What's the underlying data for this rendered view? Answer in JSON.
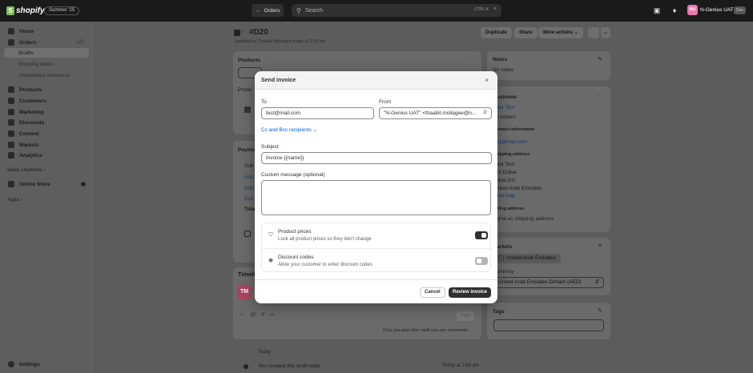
{
  "topbar": {
    "logo": "shopify",
    "season_badge": "Summer '25",
    "orders_button": "Orders",
    "search_placeholder": "Search",
    "search_shortcut": "CTRL K",
    "store_initials": "NU",
    "store_name": "N-Genius UAT",
    "dev_badge": "Dev"
  },
  "sidebar": {
    "items": [
      {
        "label": "Home",
        "icon": "home-icon"
      },
      {
        "label": "Orders",
        "icon": "orders-icon",
        "count": "125"
      },
      {
        "label": "Drafts",
        "sub": true,
        "active": true
      },
      {
        "label": "Shipping labels",
        "sub": true
      },
      {
        "label": "Abandoned checkouts",
        "sub": true
      },
      {
        "label": "Products",
        "icon": "tag-icon"
      },
      {
        "label": "Customers",
        "icon": "person-icon"
      },
      {
        "label": "Marketing",
        "icon": "target-icon"
      },
      {
        "label": "Discounts",
        "icon": "discount-icon"
      },
      {
        "label": "Content",
        "icon": "content-icon"
      },
      {
        "label": "Markets",
        "icon": "globe-icon"
      },
      {
        "label": "Analytics",
        "icon": "chart-icon"
      }
    ],
    "sales_channels_label": "Sales channels",
    "online_store_label": "Online Store",
    "apps_label": "Apps",
    "settings_label": "Settings"
  },
  "page": {
    "title": "#D20",
    "subtitle": "Updated by Thaabit Mollagee today at 2:56 am",
    "duplicate_button": "Duplicate",
    "share_button": "Share",
    "more_actions_button": "More actions",
    "products_card_title": "Products",
    "products_row_label": "Produ",
    "payment_card_title": "Payme",
    "payment_lines": [
      "Sub",
      "Add",
      "Add",
      "Esti",
      "Tota"
    ],
    "timeline_title": "Timeli",
    "timeline_avatar": "TM",
    "post_button": "Post",
    "staff_note": "Only you and other staff can see comments",
    "today_label": "Today",
    "event_text": "You created this draft order.",
    "event_time": "Today at 2:56 am"
  },
  "right_panel": {
    "notes_title": "Notes",
    "notes_text": "No notes",
    "customer_title": "Customer",
    "customer_name": "Jake Test",
    "customer_orders": "No orders",
    "contact_title": "Contact information",
    "contact_email": "test@mail.com",
    "shipping_title": "Shipping address",
    "shipping_lines": [
      "Jake Test",
      "123 Dubai",
      "Dubai DU",
      "United Arab Emirates"
    ],
    "view_map": "View map",
    "billing_title": "Billing address",
    "billing_text": "Same as shipping address",
    "markets_title": "Markets",
    "market_pill": "United Arab Emirates",
    "currency_label": "Currency",
    "currency_value": "United Arab Emirates Dirham (AED)",
    "tags_title": "Tags"
  },
  "modal": {
    "title": "Send invoice",
    "to_label": "To",
    "to_value": "test@mail.com",
    "from_label": "From",
    "from_value": "\"N-Genius UAT\" <thaabit.mollagee@n...",
    "cc_link": "Cc and Bcc recipients",
    "subject_label": "Subject",
    "subject_value": "Invoice {{name}}",
    "message_label": "Custom message (optional)",
    "message_value": "",
    "options": [
      {
        "title": "Product prices",
        "desc": "Lock all product prices so they don't change",
        "enabled": true
      },
      {
        "title": "Discount codes",
        "desc": "Allow your customer to enter discount codes",
        "enabled": false
      }
    ],
    "cancel_button": "Cancel",
    "review_button": "Review invoice"
  }
}
